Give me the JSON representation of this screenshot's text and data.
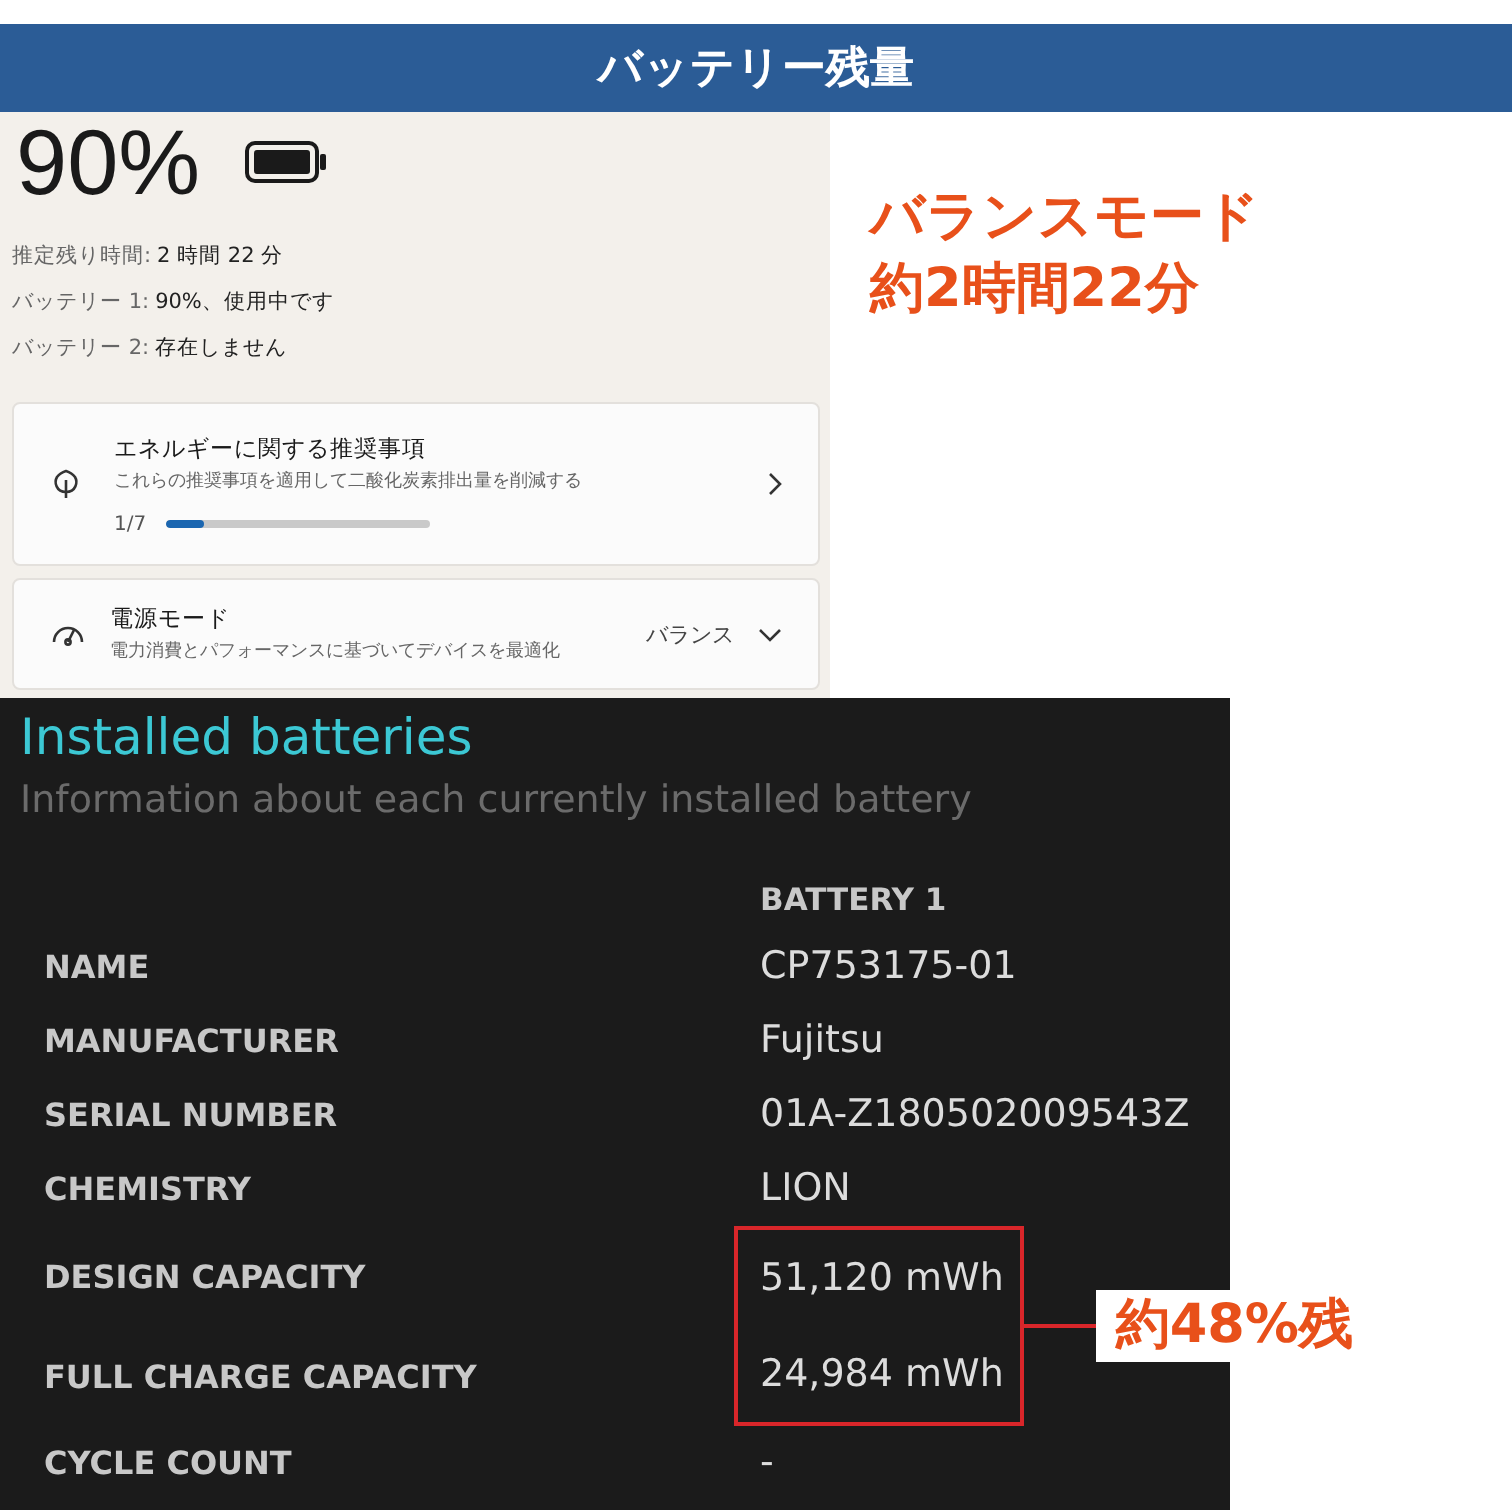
{
  "header": {
    "title": "バッテリー残量"
  },
  "battery_panel": {
    "percent": "90%",
    "info": [
      {
        "label": "推定残り時間:",
        "value": "2 時間 22 分"
      },
      {
        "label": "バッテリー 1:",
        "value": "90%、使用中です"
      },
      {
        "label": "バッテリー 2:",
        "value": "存在しません"
      }
    ],
    "cards": [
      {
        "kind": "progress",
        "title": "エネルギーに関する推奨事項",
        "subtitle": "これらの推奨事項を適用して二酸化炭素排出量を削減する",
        "count": "1/7",
        "level": 0.14
      },
      {
        "kind": "dropdown",
        "title": "電源モード",
        "subtitle": "電力消費とパフォーマンスに基づいてデバイスを最適化",
        "value": "バランス"
      }
    ]
  },
  "mode_note": {
    "lines": [
      "バランスモード",
      "約2時間22分"
    ]
  },
  "report": {
    "title": "Installed batteries",
    "subtitle": "Information about each currently installed battery",
    "column_header": "BATTERY 1",
    "rows": [
      {
        "label": "NAME",
        "value": "CP753175-01",
        "highlighted": false
      },
      {
        "label": "MANUFACTURER",
        "value": "Fujitsu",
        "highlighted": false
      },
      {
        "label": "SERIAL NUMBER",
        "value": "01A-Z180502009543Z",
        "highlighted": false
      },
      {
        "label": "CHEMISTRY",
        "value": "LION",
        "highlighted": false
      },
      {
        "label": "DESIGN CAPACITY",
        "value": "51,120 mWh",
        "highlighted": true
      },
      {
        "label": "FULL CHARGE CAPACITY",
        "value": "24,984 mWh",
        "highlighted": true
      },
      {
        "label": "CYCLE COUNT",
        "value": "-",
        "highlighted": false
      }
    ],
    "note": "約48%残"
  }
}
